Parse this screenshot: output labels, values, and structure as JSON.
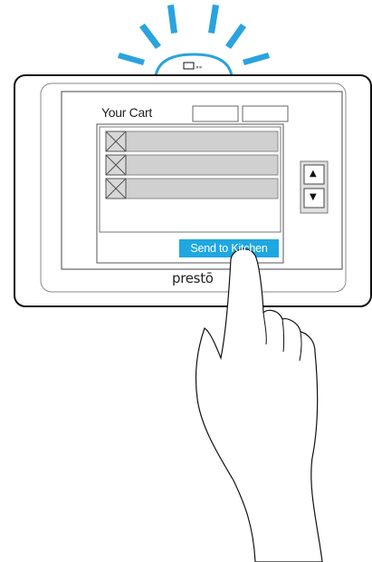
{
  "screen": {
    "cart_title": "Your Cart",
    "send_button_label": "Send to Kitchen",
    "logo_text": "prestō",
    "items": [
      {
        "image": "placeholder-image-icon",
        "label": ""
      },
      {
        "image": "placeholder-image-icon",
        "label": ""
      },
      {
        "image": "placeholder-image-icon",
        "label": ""
      }
    ],
    "scroll": {
      "up_glyph": "▲",
      "down_glyph": "▼"
    }
  },
  "beacon": {
    "icon": "card-signal-icon"
  },
  "colors": {
    "accent": "#1ea7e1",
    "beacon_stroke": "#2aa3de",
    "row_fill": "#d0d0d0",
    "outline": "#111111"
  }
}
